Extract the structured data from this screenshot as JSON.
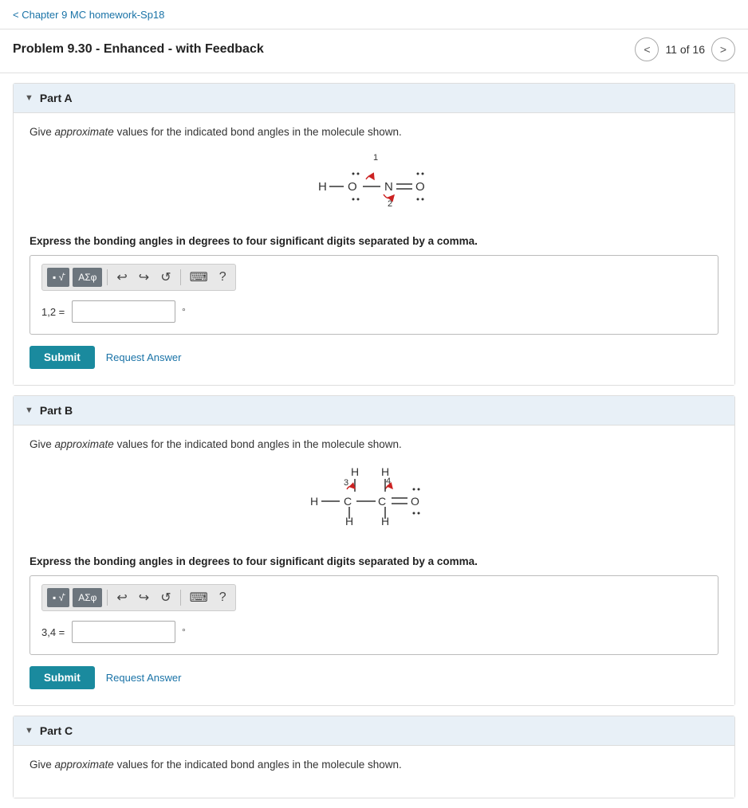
{
  "nav": {
    "breadcrumb": "< Chapter 9 MC homework-Sp18",
    "problem_title": "Problem 9.30 - Enhanced - with Feedback",
    "nav_count": "11 of 16",
    "prev_label": "<",
    "next_label": ">"
  },
  "partA": {
    "label": "Part A",
    "instruction_prefix": "Give ",
    "instruction_italic": "approximate",
    "instruction_suffix": " values for the indicated bond angles in the molecule shown.",
    "bold_instruction": "Express the bonding angles in degrees to four significant digits separated by a comma.",
    "answer_label": "1,2 =",
    "degree": "°",
    "submit_label": "Submit",
    "request_answer_label": "Request Answer",
    "toolbar": {
      "symbol_btn": "▪√̄  ΑΣφ",
      "undo": "↩",
      "redo": "↪",
      "refresh": "↺",
      "keyboard": "⌨",
      "help": "?"
    }
  },
  "partB": {
    "label": "Part B",
    "instruction_prefix": "Give ",
    "instruction_italic": "approximate",
    "instruction_suffix": " values for the indicated bond angles in the molecule shown.",
    "bold_instruction": "Express the bonding angles in degrees to four significant digits separated by a comma.",
    "answer_label": "3,4 =",
    "degree": "°",
    "submit_label": "Submit",
    "request_answer_label": "Request Answer"
  },
  "partC": {
    "label": "Part C",
    "instruction_prefix": "Give ",
    "instruction_italic": "approximate",
    "instruction_suffix": " values for the indicated bond angles in the molecule shown."
  }
}
